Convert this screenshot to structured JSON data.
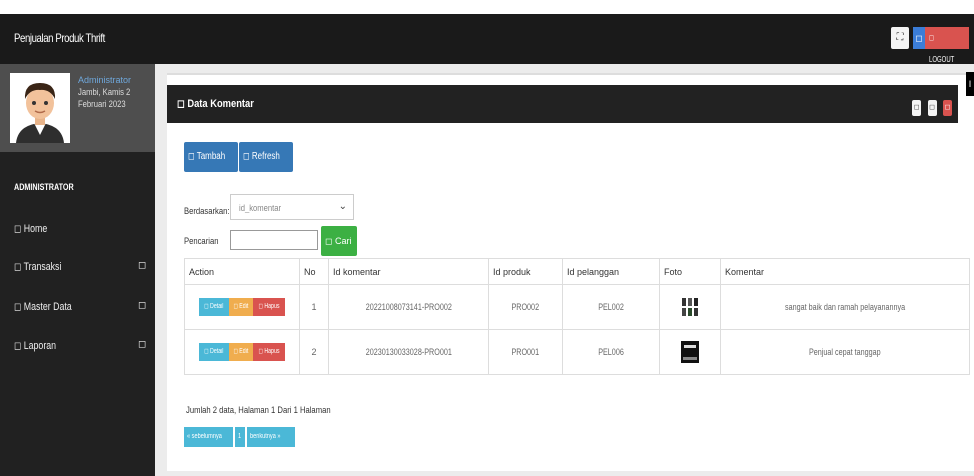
{
  "navbar": {
    "brand": "Penjualan Produk Thrift",
    "expand_icon": "⛶",
    "user_icon": "◻",
    "logout_label": "◻ LOGOUT"
  },
  "sidebar": {
    "user_name": "Administrator",
    "user_date": "Jambi, Kamis 2 Februari 2023",
    "role": "ADMINISTRATOR",
    "items": [
      {
        "label": "◻ Home",
        "caret": ""
      },
      {
        "label": "◻ Transaksi",
        "caret": "◻"
      },
      {
        "label": "◻ Master Data",
        "caret": "◻"
      },
      {
        "label": "◻ Laporan",
        "caret": "◻"
      }
    ]
  },
  "box": {
    "title": "◻   Data Komentar",
    "add_label": "◻ Tambah",
    "refresh_label": "◻ Refresh",
    "filter_label": "Berdasarkan:",
    "filter_value": "id_komentar",
    "search_label": "Pencarian",
    "search_value": "",
    "search_button": "◻ Cari"
  },
  "table": {
    "headers": [
      "Action",
      "No",
      "Id komentar",
      "Id produk",
      "Id pelanggan",
      "Foto",
      "Komentar"
    ],
    "action_labels": {
      "detail": "◻ Detail",
      "edit": "◻ Edit",
      "delete": "◻ Hapus"
    },
    "rows": [
      {
        "no": "1",
        "id_komentar": "20221008073141-PRO002",
        "id_produk": "PRO002",
        "id_pelanggan": "PEL002",
        "komentar": "sangat baik dan ramah pelayanannya"
      },
      {
        "no": "2",
        "id_komentar": "20230130033028-PRO001",
        "id_produk": "PRO001",
        "id_pelanggan": "PEL006",
        "komentar": "Penjual cepat tanggap"
      }
    ]
  },
  "footer": {
    "info": "Jumlah 2 data, Halaman 1 Dari 1 Halaman",
    "prev": "« sebelumnya",
    "page": "1",
    "next": "berikutnya »"
  },
  "colors": {
    "navbar": "#1a1a1a",
    "sidebar": "#212121",
    "primary": "#3678b6",
    "success": "#3cb043",
    "danger": "#d9534f",
    "warning": "#f0ad4e",
    "info": "#4bb8d7"
  }
}
